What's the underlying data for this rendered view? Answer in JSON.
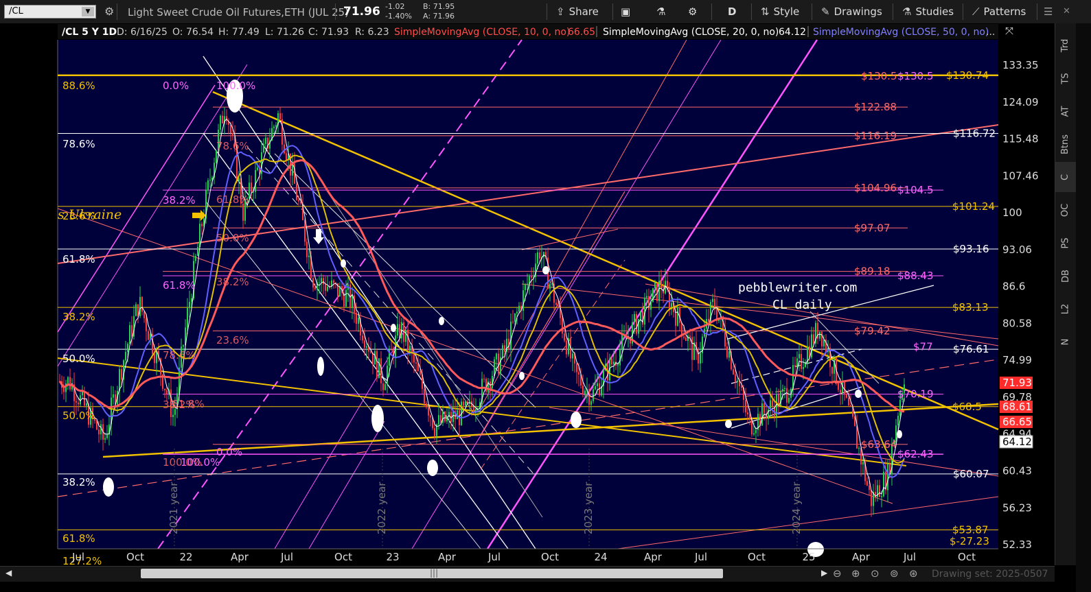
{
  "toolbar": {
    "symbol": "/CL",
    "description": "Light Sweet Crude Oil Futures,ETH (JUL 25)",
    "last": "71.96",
    "change": "-1.02",
    "change_pct": "-1.40%",
    "bid": "B: 71.95",
    "ask": "A: 71.96",
    "share": "Share",
    "period": "D",
    "style": "Style",
    "drawings": "Drawings",
    "studies": "Studies",
    "patterns": "Patterns"
  },
  "header": {
    "symbol_period": "/CL 5 Y 1D",
    "date": "D: 6/16/25",
    "open": "O: 76.54",
    "high": "H: 77.49",
    "low": "L: 71.26",
    "close": "C: 71.93",
    "range": "R: 6.23",
    "sma10": "SimpleMovingAvg (CLOSE, 10, 0, no)",
    "sma10_val": "66.65",
    "sma20": "SimpleMovingAvg (CLOSE, 20, 0, no)",
    "sma20_val": "64.12",
    "sma50": "SimpleMovingAvg (CLOSE, 50, 0, no)",
    "more": "..."
  },
  "sidebar": [
    "Trd",
    "TS",
    "AT",
    "Btns",
    "C",
    "OC",
    "PS",
    "DB",
    "L2",
    "N"
  ],
  "scrollbar": {
    "drawing_set": "Drawing set: 2025-0507"
  },
  "colors": {
    "background": "#00003a",
    "sma10": "#ff4d4d",
    "sma20": "#e0c000",
    "sma50": "#6060ff",
    "gold": "#f2c200",
    "magenta": "#ff55ff",
    "orange_red": "#ff6060"
  },
  "chart_data": {
    "type": "candlestick",
    "annotations": {
      "watermark_1": "pebblewriter.com",
      "watermark_2": "CL daily",
      "left_label": "s Ukraine"
    },
    "y_ticks": [
      "133.35",
      "124.09",
      "115.48",
      "107.46",
      "100",
      "93.06",
      "86.6",
      "80.58",
      "74.99",
      "69.78",
      "64.94",
      "60.43",
      "56.23",
      "52.33"
    ],
    "x_ticks": [
      "Jul",
      "Oct",
      "22",
      "Apr",
      "Jul",
      "Oct",
      "23",
      "Apr",
      "Jul",
      "Oct",
      "24",
      "Apr",
      "Jul",
      "Oct",
      "25",
      "Apr",
      "Jul",
      "Oct"
    ],
    "year_labels": [
      "2021 year",
      "2022 year",
      "2023 year",
      "2024 year"
    ],
    "price_badges": [
      {
        "value": "71.93",
        "bg": "#ff2a2a",
        "fg": "#ffffff"
      },
      {
        "value": "68.61",
        "bg": "#ff3030",
        "fg": "#ffffff"
      },
      {
        "value": "66.65",
        "bg": "#ff3030",
        "fg": "#ffffff"
      },
      {
        "value": "64.12",
        "bg": "#ffffff",
        "fg": "#000000"
      }
    ],
    "levels": [
      {
        "label": "$130.5",
        "value": 130.5,
        "color": "#ff6a6a"
      },
      {
        "label": "$130.5",
        "value": 130.5,
        "color": "#ff66ff"
      },
      {
        "label": "$130.74",
        "value": 130.74,
        "color": "#f2c200"
      },
      {
        "label": "$122.88",
        "value": 122.88,
        "color": "#ff6a6a"
      },
      {
        "label": "$116.19",
        "value": 116.19,
        "color": "#ff6a6a"
      },
      {
        "label": "$116.72",
        "value": 116.72,
        "color": "#ffffff"
      },
      {
        "label": "$104.96",
        "value": 104.96,
        "color": "#ff6a6a"
      },
      {
        "label": "$104.5",
        "value": 104.5,
        "color": "#ff66ff"
      },
      {
        "label": "$101.24",
        "value": 101.24,
        "color": "#f2c200"
      },
      {
        "label": "$97.07",
        "value": 97.07,
        "color": "#ff6a6a"
      },
      {
        "label": "$93.16",
        "value": 93.16,
        "color": "#ffffff"
      },
      {
        "label": "$89.18",
        "value": 89.18,
        "color": "#ff6a6a"
      },
      {
        "label": "$88.43",
        "value": 88.43,
        "color": "#ff66ff"
      },
      {
        "label": "$83.13",
        "value": 83.13,
        "color": "#f2c200"
      },
      {
        "label": "$79.42",
        "value": 79.42,
        "color": "#ff6a6a"
      },
      {
        "label": "$77",
        "value": 77,
        "color": "#ff66ff"
      },
      {
        "label": "$76.61",
        "value": 76.61,
        "color": "#ffffff"
      },
      {
        "label": "$70.19",
        "value": 70.19,
        "color": "#ff66ff"
      },
      {
        "label": "$68.5",
        "value": 68.5,
        "color": "#f2c200"
      },
      {
        "label": "$63.64",
        "value": 63.64,
        "color": "#ff6a6a"
      },
      {
        "label": "$62.43",
        "value": 62.43,
        "color": "#ff66ff"
      },
      {
        "label": "$60.07",
        "value": 60.07,
        "color": "#ffffff"
      },
      {
        "label": "$53.87",
        "value": 53.87,
        "color": "#f2c200"
      },
      {
        "label": "$-27.23",
        "value": -27.23,
        "color": "#f2c200"
      }
    ],
    "fib_left_labels": [
      {
        "text": "88.6%",
        "color": "#f2c200"
      },
      {
        "text": "78.6%",
        "color": "#ffffff"
      },
      {
        "text": "23.6%",
        "color": "#f2c200"
      },
      {
        "text": "61.8%",
        "color": "#ffffff"
      },
      {
        "text": "38.2%",
        "color": "#f2c200"
      },
      {
        "text": "50.0%",
        "color": "#ffffff"
      },
      {
        "text": "50.0%",
        "color": "#f2c200"
      },
      {
        "text": "38.2%",
        "color": "#ffffff"
      },
      {
        "text": "61.8%",
        "color": "#f2c200"
      },
      {
        "text": "127.2%",
        "color": "#f2c200"
      },
      {
        "text": "0.0%",
        "color": "#ff66ff"
      },
      {
        "text": "100.0%",
        "color": "#ff66ff"
      },
      {
        "text": "38.2%",
        "color": "#ff66ff"
      },
      {
        "text": "61.8%",
        "color": "#ff66ff"
      },
      {
        "text": "0.0%",
        "color": "#ff66ff"
      },
      {
        "text": "100.0%",
        "color": "#ff66ff"
      },
      {
        "text": "78.6%",
        "color": "#ff6a6a"
      },
      {
        "text": "38.2%",
        "color": "#ff6a6a"
      },
      {
        "text": "23.6%",
        "color": "#ff6a6a"
      },
      {
        "text": "61.8%",
        "color": "#ff6a6a"
      },
      {
        "text": "50.0%",
        "color": "#ff6a6a"
      },
      {
        "text": "78.6%",
        "color": "#ff6a6a"
      },
      {
        "text": "38.2%",
        "color": "#ff6a6a"
      },
      {
        "text": "100.0%",
        "color": "#ff6a6a"
      },
      {
        "text": "61.8%",
        "color": "#ff6a6a"
      }
    ],
    "price_path": [
      [
        "2021-06",
        72
      ],
      [
        "2021-08",
        64
      ],
      [
        "2021-10",
        84
      ],
      [
        "2021-12",
        67
      ],
      [
        "2022-03",
        124
      ],
      [
        "2022-04",
        100
      ],
      [
        "2022-06",
        121
      ],
      [
        "2022-08",
        88
      ],
      [
        "2022-10",
        85
      ],
      [
        "2022-12",
        72
      ],
      [
        "2023-01",
        80
      ],
      [
        "2023-03",
        66
      ],
      [
        "2023-05",
        68
      ],
      [
        "2023-07",
        76
      ],
      [
        "2023-09",
        93
      ],
      [
        "2023-11",
        73
      ],
      [
        "2023-12",
        70
      ],
      [
        "2024-01",
        74
      ],
      [
        "2024-04",
        87
      ],
      [
        "2024-06",
        75
      ],
      [
        "2024-07",
        84
      ],
      [
        "2024-09",
        66
      ],
      [
        "2024-11",
        70
      ],
      [
        "2025-01",
        80
      ],
      [
        "2025-03",
        66
      ],
      [
        "2025-04",
        57
      ],
      [
        "2025-05",
        60
      ],
      [
        "2025-06",
        74
      ],
      [
        "2025-06-16",
        71.93
      ]
    ]
  }
}
